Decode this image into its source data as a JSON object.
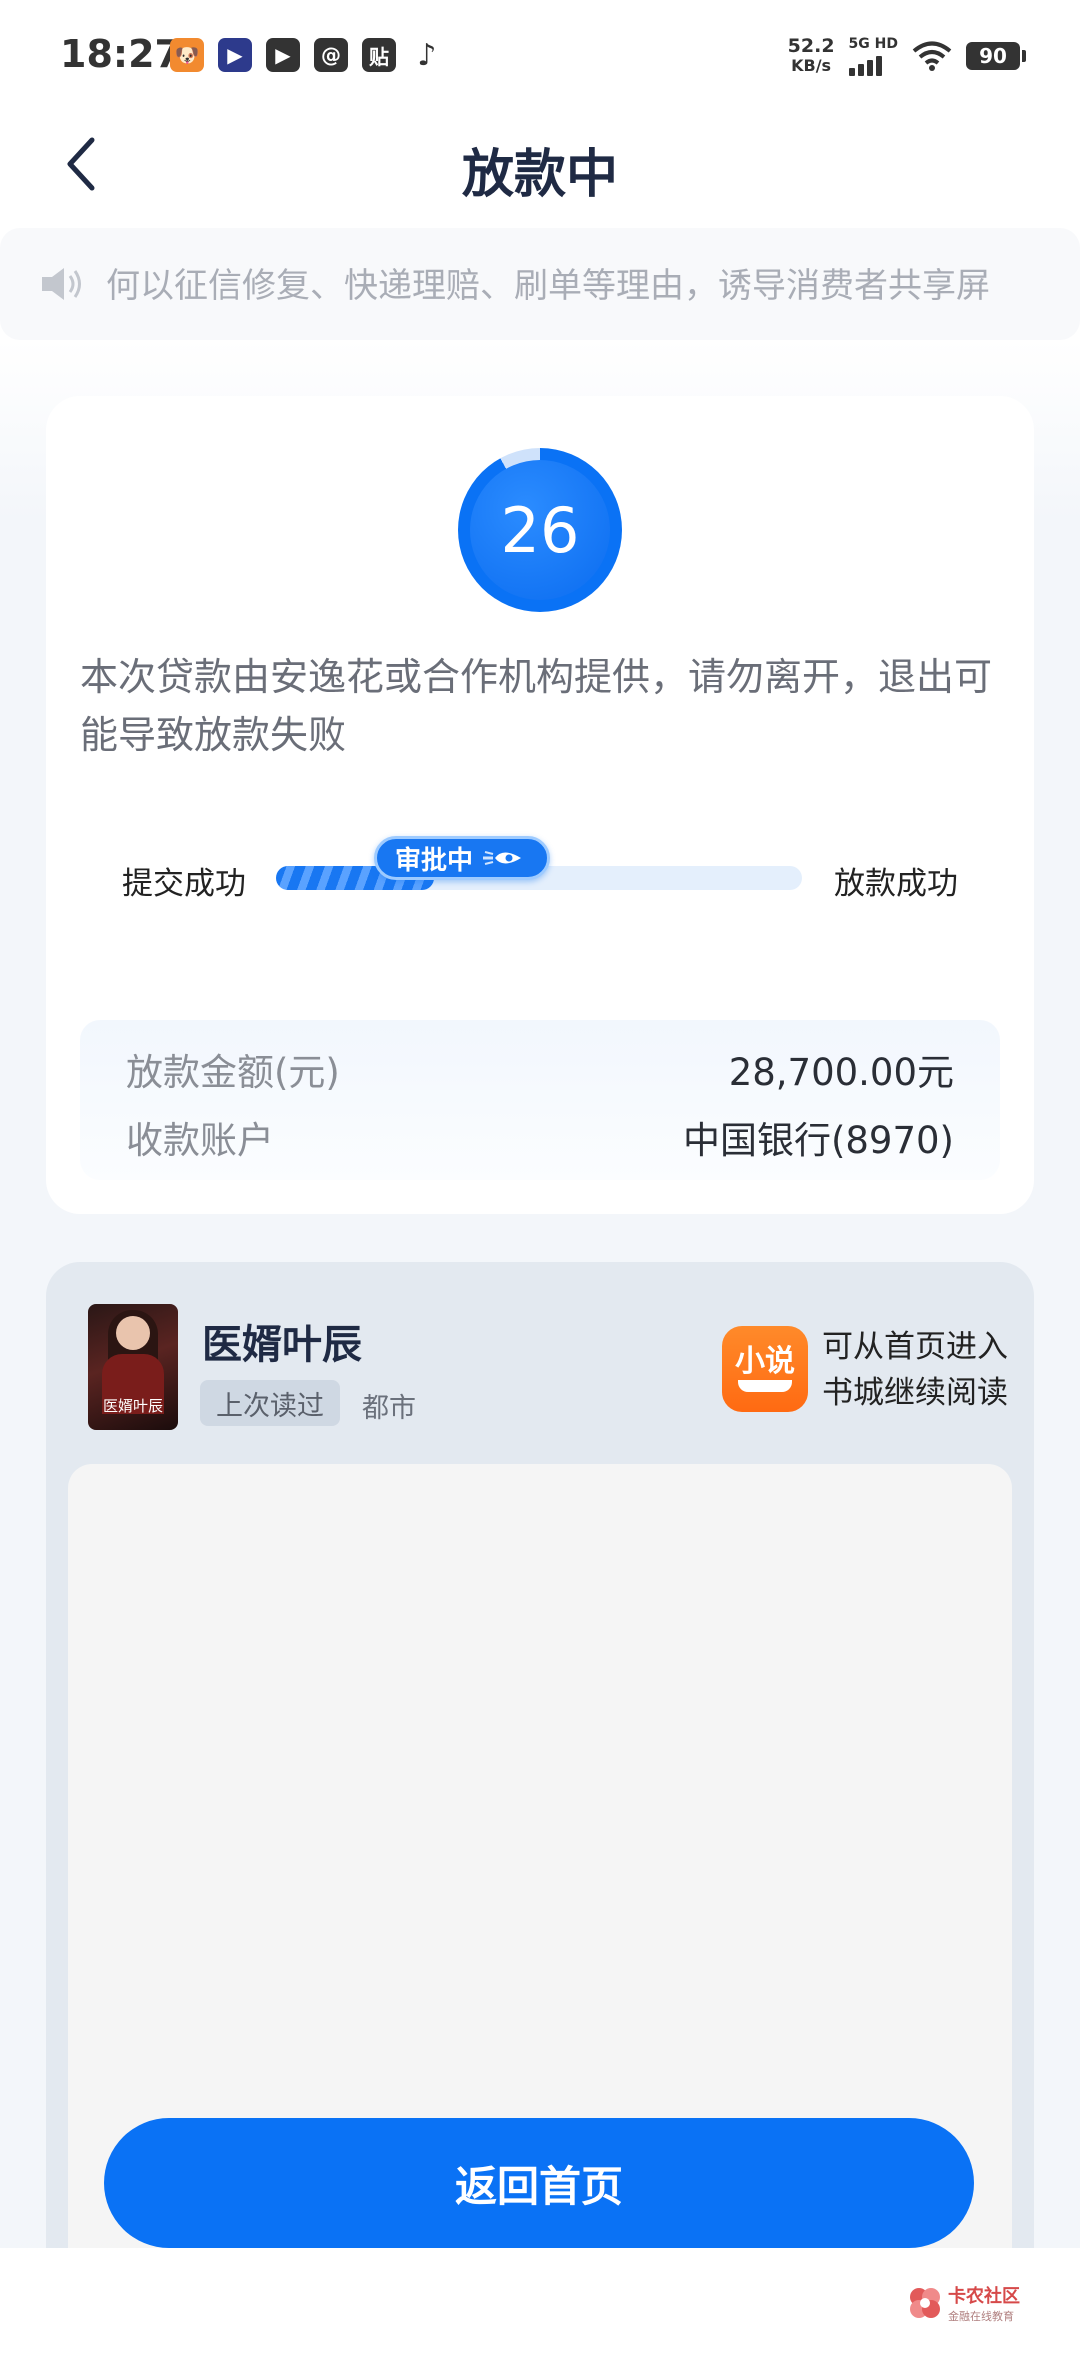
{
  "status_bar": {
    "time": "18:27",
    "app_icons": [
      {
        "name": "puppy-app-icon",
        "glyph": "🐶",
        "color": "#f28a2f"
      },
      {
        "name": "video-app-icon",
        "glyph": "▶",
        "color": "#2d3a8c"
      },
      {
        "name": "play-app-icon",
        "glyph": "▶",
        "color": "#333333"
      },
      {
        "name": "search-app-icon",
        "glyph": "@",
        "color": "#333333"
      },
      {
        "name": "tieba-app-icon",
        "glyph": "贴",
        "color": "#333333"
      },
      {
        "name": "tiktok-app-icon",
        "glyph": "♪",
        "color": "#333333"
      }
    ],
    "net_speed_value": "52.2",
    "net_speed_unit": "KB/s",
    "signal_label": "5G HD",
    "battery": "90"
  },
  "header": {
    "title": "放款中"
  },
  "notice": {
    "text": "何以征信修复、快递理赔、刷单等理由，诱导消费者共享屏"
  },
  "countdown": {
    "value": "26",
    "progress_fraction": 0.92
  },
  "loan_message": "本次贷款由安逸花或合作机构提供，请勿离开，退出可能导致放款失败",
  "progress": {
    "step_start": "提交成功",
    "step_current": "审批中",
    "step_end": "放款成功",
    "fill_fraction": 0.3
  },
  "loan_details": {
    "amount_label": "放款金额(元)",
    "amount_value": "28,700.00元",
    "account_label": "收款账户",
    "account_value": "中国银行(8970)"
  },
  "reader": {
    "book_title": "医婿叶辰",
    "cover_title": "医婿叶辰",
    "read_tag": "上次读过",
    "genre": "都市",
    "app_icon_text": "小说",
    "tip_line1": "可从首页进入",
    "tip_line2": "书城继续阅读"
  },
  "home_button": "返回首页",
  "watermark": {
    "main": "卡农社区",
    "sub": "金融在线教育"
  },
  "colors": {
    "primary": "#0a72f5",
    "title": "#1f2a44",
    "muted": "#a9adb6"
  }
}
